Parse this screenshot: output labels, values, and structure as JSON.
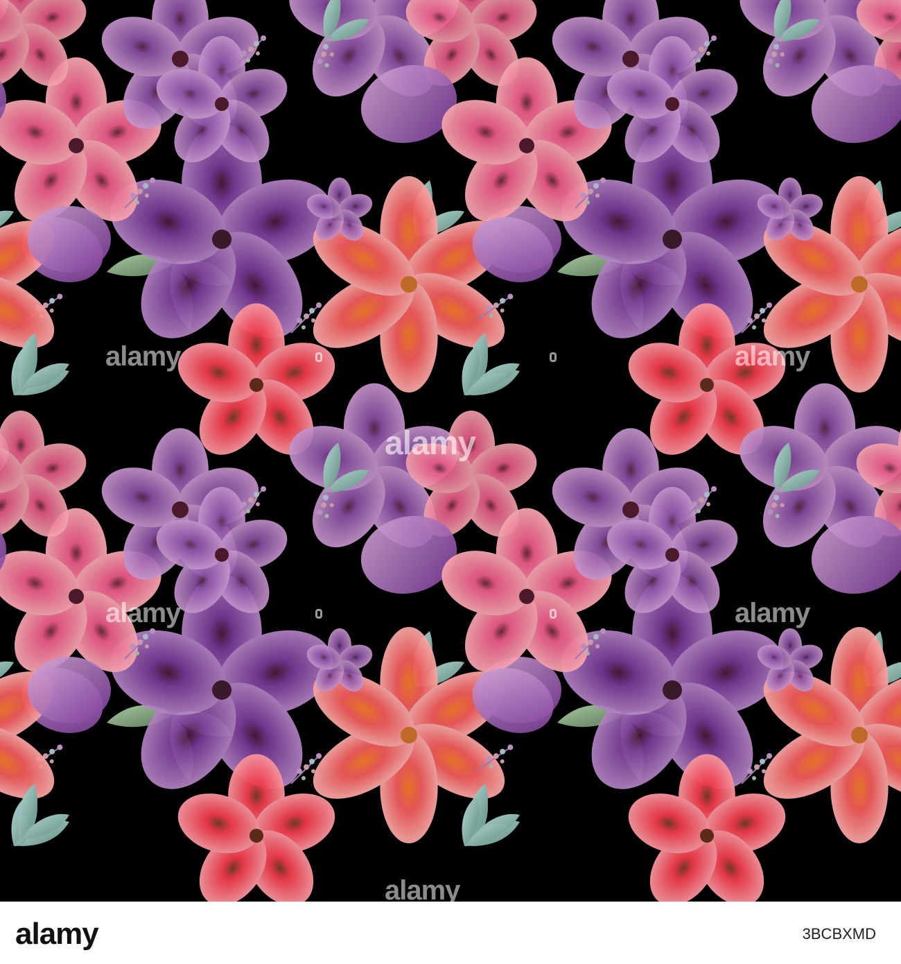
{
  "artwork": {
    "background": "#000000",
    "watermark_text": "alamy",
    "colors": {
      "lilac": "#a86fb6",
      "purple": "#8a4fa3",
      "pink": "#e86a8f",
      "coral": "#f25a4a",
      "orange": "#f28a3a",
      "leaf": "#7fa07a",
      "leaf_blue": "#8fb8b8"
    }
  },
  "footer": {
    "logo": "alamy",
    "image_id": "3BCBXMD"
  }
}
